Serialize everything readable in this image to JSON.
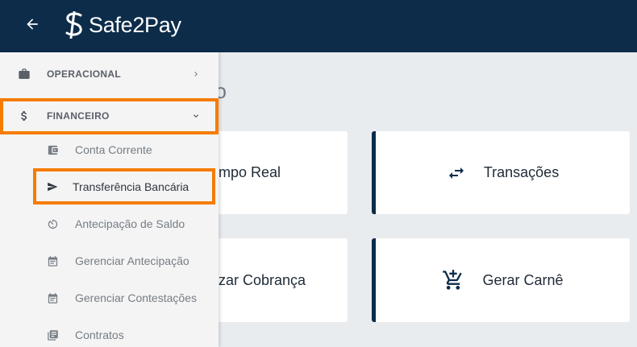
{
  "app": {
    "logo_text": "Safe2Pay"
  },
  "main": {
    "title_fragment": "do",
    "cards": [
      {
        "label": "mpo Real"
      },
      {
        "label": "Transações",
        "icon": "swap-arrows-icon"
      },
      {
        "label": "zar Cobrança"
      },
      {
        "label": "Gerar Carnê",
        "icon": "add-cart-icon"
      }
    ]
  },
  "sidebar": {
    "sections": [
      {
        "label": "OPERACIONAL",
        "icon": "briefcase-icon",
        "expanded": false
      },
      {
        "label": "FINANCEIRO",
        "icon": "dollar-icon",
        "expanded": true
      }
    ],
    "items": [
      {
        "label": "Conta Corrente",
        "icon": "wallet-icon"
      },
      {
        "label": "Transferência Bancária",
        "icon": "send-icon"
      },
      {
        "label": "Antecipação de Saldo",
        "icon": "timer-icon"
      },
      {
        "label": "Gerenciar Antecipação",
        "icon": "calendar-icon"
      },
      {
        "label": "Gerenciar Contestações",
        "icon": "calendar-icon"
      },
      {
        "label": "Contratos",
        "icon": "library-icon"
      }
    ]
  },
  "colors": {
    "header_bg": "#0d2c4a",
    "highlight": "#f57c00",
    "sidebar_bg": "#f4f4f4",
    "page_bg": "#e9ecef"
  }
}
